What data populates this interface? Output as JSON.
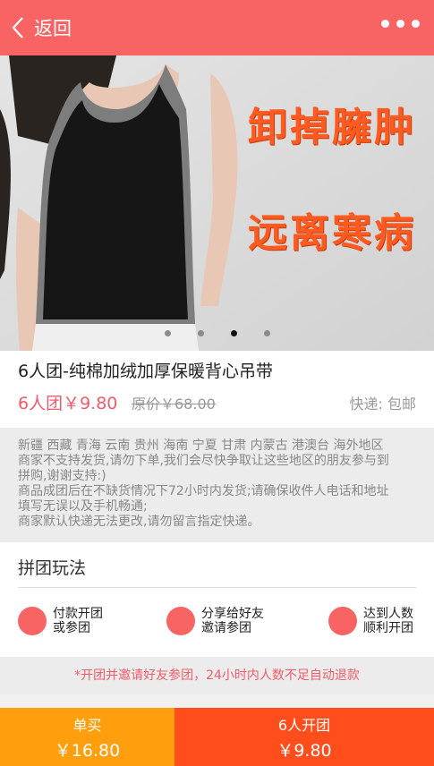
{
  "header": {
    "back_label": "返回",
    "colors": {
      "bar": "#f86464"
    },
    "icons": {
      "back": "chevron-left-icon",
      "more": "more-icon"
    }
  },
  "banner": {
    "promo_line1": "卸掉臃肿",
    "promo_line2": "远离寒病",
    "carousel": {
      "total": 4,
      "active_index": 3
    }
  },
  "product": {
    "title": "6人团-纯棉加绒加厚保暖背心吊带",
    "group_price": "6人团￥9.80",
    "original_price": "原价￥68.00",
    "shipping": "快递: 包邮"
  },
  "notice": {
    "lines": [
      "新疆 西藏 青海 云南 贵州 海南 宁夏 甘肃 内蒙古 港澳台 海外地区",
      "商家不支持发货,请勿下单,我们会尽快争取让这些地区的朋友参与到",
      "拼购,谢谢支持:)",
      "商品成团后在不缺货情况下72小时内发货;请确保收件人电话和地址",
      "填写无误以及手机畅通;",
      "商家默认快递无法更改,请勿留言指定快递。"
    ]
  },
  "play": {
    "title": "拼团玩法",
    "steps": [
      {
        "line1": "付款开团",
        "line2": "或参团"
      },
      {
        "line1": "分享给好友",
        "line2": "邀请参团"
      },
      {
        "line1": "达到人数",
        "line2": "顺利开团"
      }
    ]
  },
  "tip": "*开团并邀请好友参团，24小时内人数不足自动退款",
  "footer": {
    "single": {
      "label": "单买",
      "price": "￥16.80"
    },
    "group": {
      "label": "6人开团",
      "price": "￥9.80"
    },
    "colors": {
      "single": "#ff9f0d",
      "group": "#ff4e1c"
    }
  }
}
